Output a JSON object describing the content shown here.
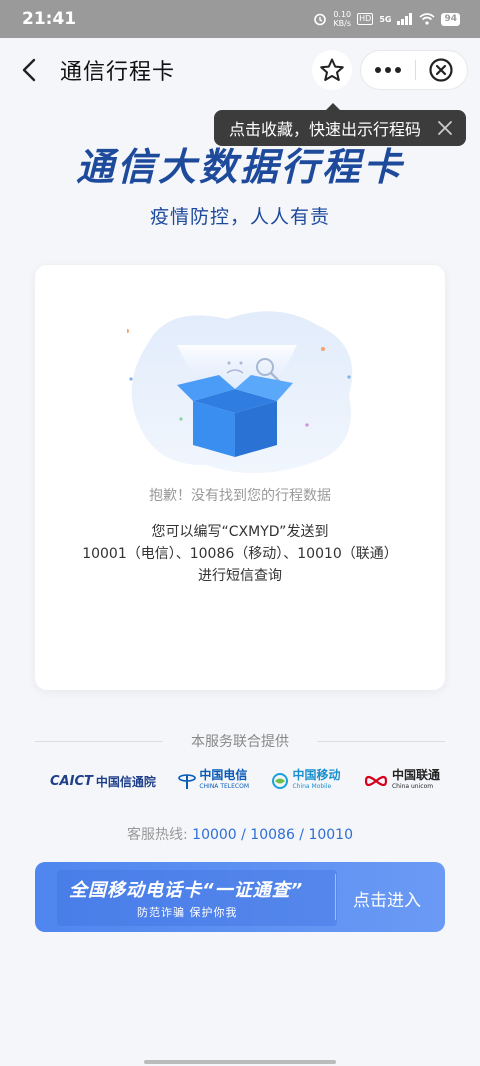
{
  "status_bar": {
    "time": "21:41",
    "speed_value": "0.10",
    "speed_unit": "KB/s",
    "hd": "HD",
    "network": "5G",
    "battery": "94"
  },
  "nav": {
    "title": "通信行程卡"
  },
  "tooltip": {
    "text": "点击收藏，快速出示行程码"
  },
  "hero": {
    "title": "通信大数据行程卡",
    "subtitle": "疫情防控，人人有责"
  },
  "card": {
    "sorry_text": "抱歉！没有找到您的行程数据",
    "instr_line1": "您可以编写“CXMYD”发送到",
    "instr_line2": "10001（电信）、10086（移动）、10010（联通）",
    "instr_line3": "进行短信查询"
  },
  "providers": {
    "label": "本服务联合提供",
    "caict_abbr": "CAICT",
    "caict_name": "中国信通院",
    "telecom_name": "中国电信",
    "telecom_en": "CHINA TELECOM",
    "mobile_name": "中国移动",
    "mobile_en": "China Mobile",
    "unicom_name": "中国联通",
    "unicom_en": "China unicom"
  },
  "hotline": {
    "label": "客服热线:",
    "numbers": "10000 / 10086 / 10010"
  },
  "banner": {
    "title": "全国移动电话卡“一证通查”",
    "subtitle": "防范诈骗 保护你我",
    "button": "点击进入"
  },
  "colors": {
    "brand_blue": "#1e4a9c",
    "banner_blue": "#4f86ef",
    "link_blue": "#2f6fd6"
  }
}
